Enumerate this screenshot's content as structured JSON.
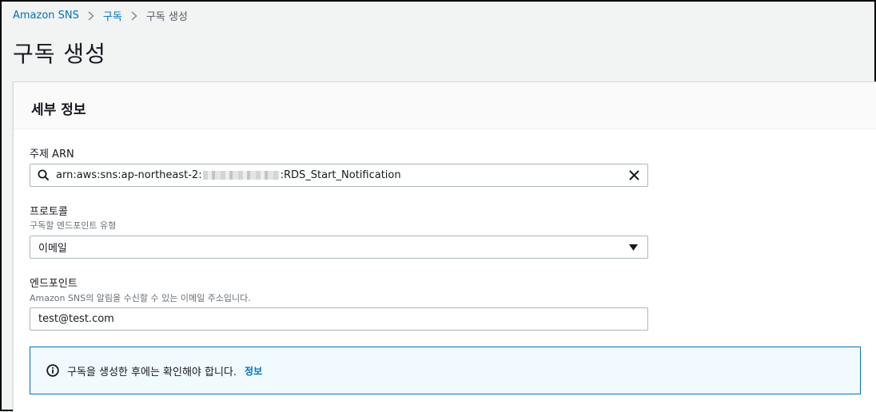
{
  "breadcrumb": {
    "items": [
      "Amazon SNS",
      "구독",
      "구독 생성"
    ]
  },
  "page": {
    "title": "구독 생성"
  },
  "details": {
    "title": "세부 정보",
    "topic_arn": {
      "label": "주제 ARN",
      "value_prefix": "arn:aws:sns:ap-northeast-2:",
      "value_suffix": ":RDS_Start_Notification"
    },
    "protocol": {
      "label": "프로토콜",
      "description": "구독할 엔드포인트 유형",
      "selected": "이메일"
    },
    "endpoint": {
      "label": "엔드포인트",
      "description": "Amazon SNS의 알림을 수신할 수 있는 이메일 주소입니다.",
      "value": "test@test.com"
    },
    "alert": {
      "text": "구독을 생성한 후에는 확인해야 합니다.",
      "link": "정보"
    }
  },
  "colors": {
    "link": "#0073bb",
    "alert_border": "#0073bb",
    "alert_bg": "#f1faff",
    "page_bg": "#f2f3f3"
  },
  "icons": [
    "chevron-right-icon",
    "search-icon",
    "close-icon",
    "caret-down-icon",
    "info-icon"
  ]
}
